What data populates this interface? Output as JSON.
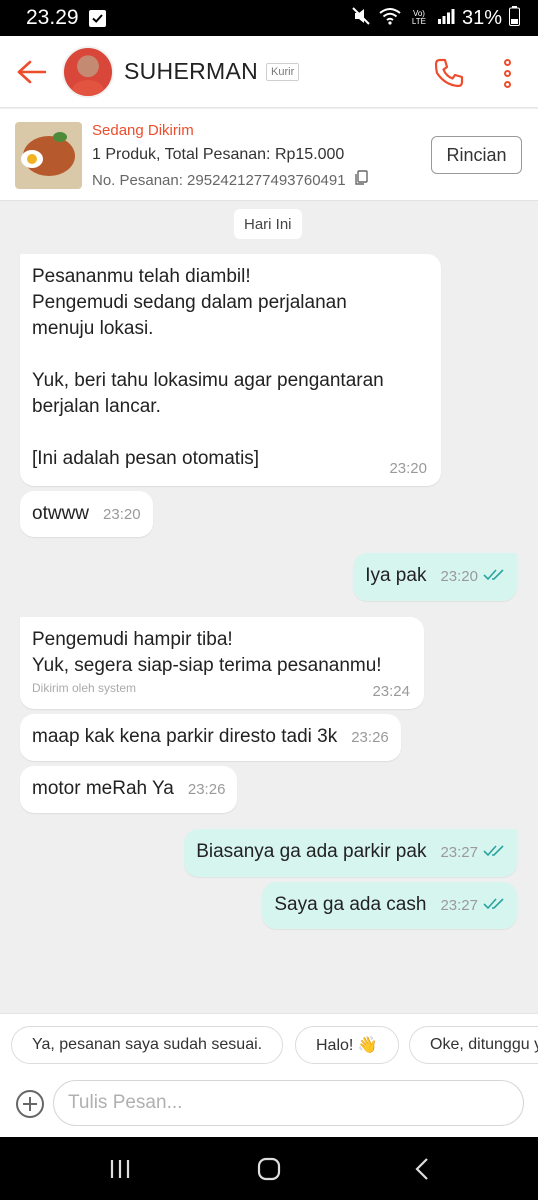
{
  "status_bar": {
    "time": "23.29",
    "network": "Vo) LTE",
    "battery": "31%"
  },
  "header": {
    "name": "SUHERMAN",
    "role": "Kurir"
  },
  "order": {
    "status": "Sedang Dikirim",
    "summary": "1 Produk, Total Pesanan: Rp15.000",
    "number": "No. Pesanan: 2952421277493760491",
    "details_button": "Rincian"
  },
  "chat": {
    "date_label": "Hari Ini",
    "messages": [
      {
        "direction": "in",
        "text": "Pesananmu telah diambil!\nPengemudi sedang dalam perjalanan\nmenuju lokasi.\n\nYuk, beri tahu lokasimu agar pengantaran\nberjalan lancar.\n\n[Ini adalah pesan otomatis]",
        "time": "23:20"
      },
      {
        "direction": "in",
        "text": "otwww",
        "time": "23:20"
      },
      {
        "direction": "out",
        "text": "Iya pak",
        "time": "23:20",
        "read": true
      },
      {
        "direction": "in",
        "text": "Pengemudi hampir tiba!\nYuk, segera siap-siap terima pesananmu!",
        "sender": "Dikirim oleh system",
        "time": "23:24"
      },
      {
        "direction": "in",
        "text": "maap kak kena parkir diresto tadi 3k",
        "time": "23:26"
      },
      {
        "direction": "in",
        "text": "motor meRah Ya",
        "time": "23:26"
      },
      {
        "direction": "out",
        "text": "Biasanya ga ada parkir pak",
        "time": "23:27",
        "read": true
      },
      {
        "direction": "out",
        "text": "Saya ga ada cash",
        "time": "23:27",
        "read": true
      }
    ]
  },
  "quick_replies": [
    "Ya, pesanan saya sudah sesuai.",
    "Halo! 👋",
    "Oke, ditunggu y"
  ],
  "composer": {
    "placeholder": "Tulis Pesan..."
  },
  "colors": {
    "accent": "#ee4d2d",
    "outgoing_bubble": "#d7f5ef",
    "incoming_bubble": "#ffffff",
    "background": "#efefef",
    "read_tick": "#2aa4a0"
  }
}
